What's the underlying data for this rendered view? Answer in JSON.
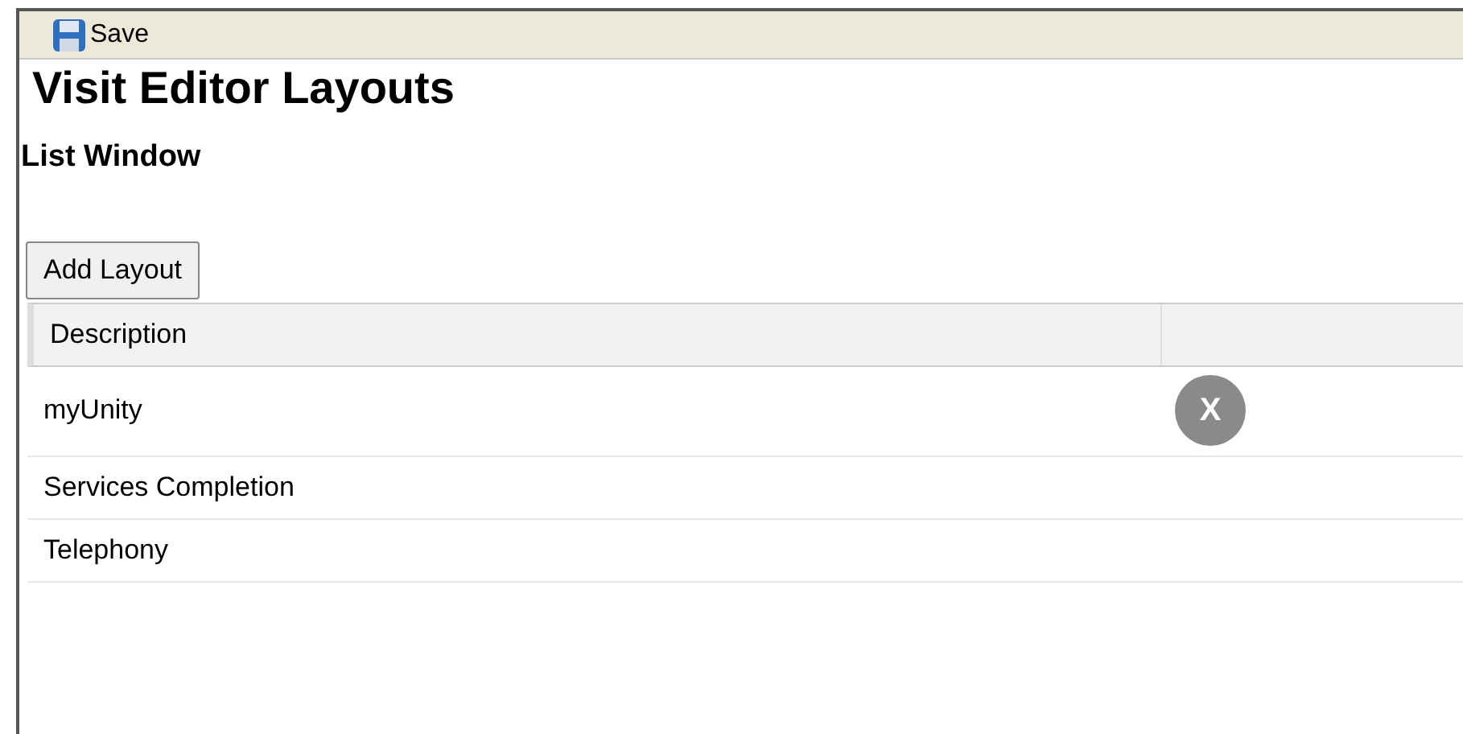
{
  "toolbar": {
    "save_button": "Save"
  },
  "title": "Visit Editor Layouts",
  "subtitle": "List Window",
  "add_button": "Add Layout",
  "table": {
    "columns": [
      "Description"
    ],
    "rows": [
      {
        "description": "myUnity",
        "delete_button": "X"
      },
      {
        "description": "Services Completion"
      },
      {
        "description": "Telephony"
      }
    ]
  }
}
